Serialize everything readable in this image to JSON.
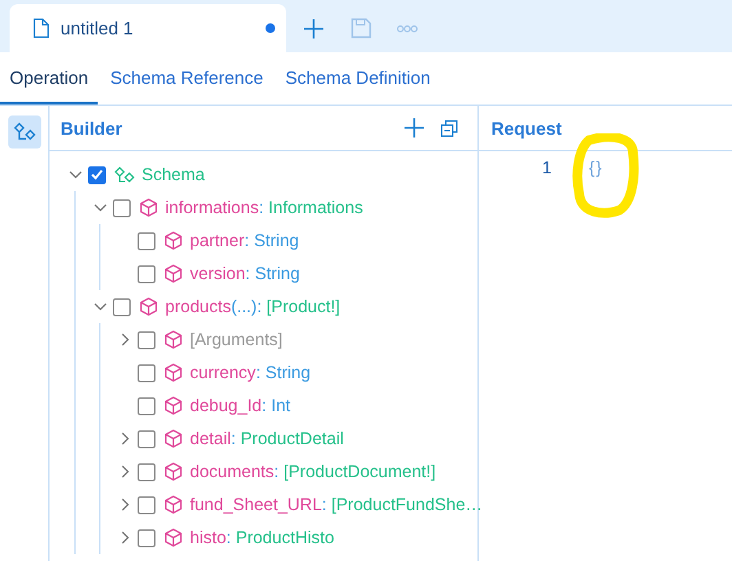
{
  "document_tab": {
    "title": "untitled 1",
    "modified": true
  },
  "sub_tabs": [
    {
      "label": "Operation",
      "selected": true
    },
    {
      "label": "Schema Reference",
      "selected": false
    },
    {
      "label": "Schema Definition",
      "selected": false
    }
  ],
  "side_tool": {
    "selected": true
  },
  "builder": {
    "title": "Builder",
    "tree": [
      {
        "kind": "root",
        "name": "Schema",
        "checked": true,
        "expandable": true,
        "expanded": true,
        "children": [
          {
            "kind": "object_field",
            "name": "informations",
            "sep": ":",
            "type": "Informations",
            "checked": false,
            "expandable": true,
            "expanded": true,
            "children": [
              {
                "kind": "scalar_field",
                "name": "partner",
                "sep": ":",
                "type": "String",
                "checked": false,
                "expandable": false
              },
              {
                "kind": "scalar_field",
                "name": "version",
                "sep": ":",
                "type": "String",
                "checked": false,
                "expandable": false
              }
            ]
          },
          {
            "kind": "object_field",
            "name": "products",
            "args": "(...)",
            "sep": ":",
            "type": "[Product!]",
            "checked": false,
            "expandable": true,
            "expanded": true,
            "children": [
              {
                "kind": "arguments",
                "name": "[Arguments]",
                "checked": false,
                "expandable": true,
                "expanded": false
              },
              {
                "kind": "scalar_field",
                "name": "currency",
                "sep": ":",
                "type": "String",
                "checked": false,
                "expandable": false
              },
              {
                "kind": "scalar_field",
                "name": "debug_Id",
                "sep": ":",
                "type": "Int",
                "checked": false,
                "expandable": false
              },
              {
                "kind": "object_field",
                "name": "detail",
                "sep": ":",
                "type": "ProductDetail",
                "checked": false,
                "expandable": true,
                "expanded": false
              },
              {
                "kind": "object_field",
                "name": "documents",
                "sep": ":",
                "type": "[ProductDocument!]",
                "checked": false,
                "expandable": true,
                "expanded": false
              },
              {
                "kind": "object_field",
                "name": "fund_Sheet_URL",
                "sep": ":",
                "type": "[ProductFundShe…",
                "checked": false,
                "expandable": true,
                "expanded": false
              },
              {
                "kind": "object_field",
                "name": "histo",
                "sep": ":",
                "type": "ProductHisto",
                "checked": false,
                "expandable": true,
                "expanded": false
              }
            ]
          }
        ]
      }
    ]
  },
  "request": {
    "title": "Request",
    "lines": [
      {
        "number": "1",
        "text": "{}"
      }
    ]
  },
  "annotations": [
    {
      "kind": "circle",
      "color": "#ffe600"
    }
  ]
}
